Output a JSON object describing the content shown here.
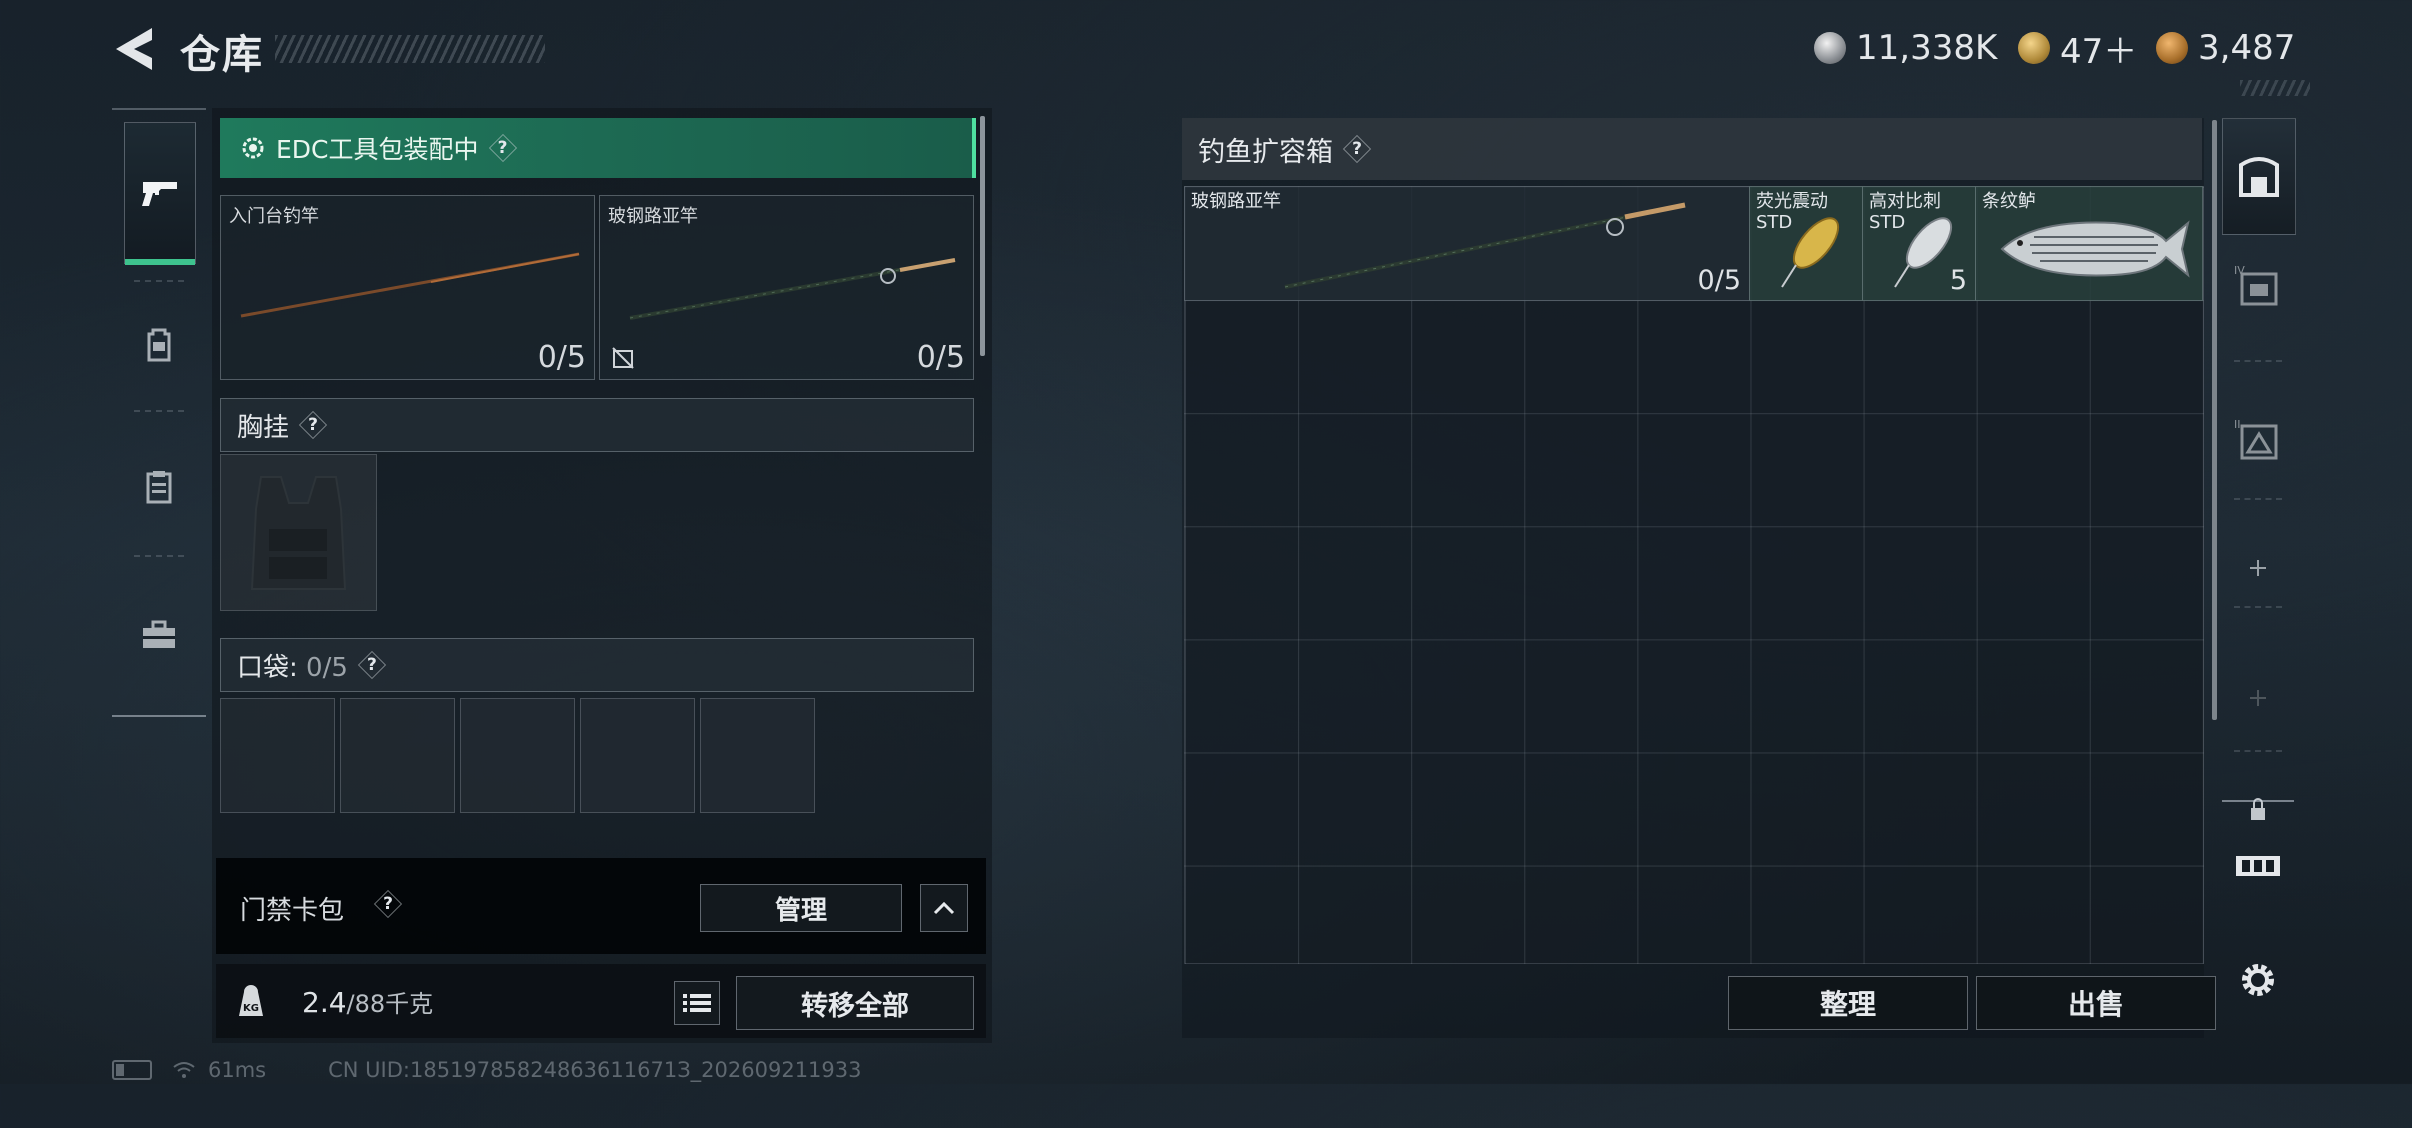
{
  "header": {
    "title": "仓库",
    "currencies": [
      {
        "icon": "silver-coin-icon",
        "value": "11,338K"
      },
      {
        "icon": "gold-triangle-coin-icon",
        "value": "47＋"
      },
      {
        "icon": "bronze-coin-icon",
        "value": "3,487"
      }
    ]
  },
  "colors": {
    "accent_green": "#1f7a5c",
    "accent_green_edge": "#4fe0a0",
    "panel_bg": "#0e141a"
  },
  "left_tabs": [
    {
      "icon": "pistol-icon",
      "active": true
    },
    {
      "icon": "backpack-icon",
      "active": false
    },
    {
      "icon": "clipboard-icon",
      "active": false
    },
    {
      "icon": "toolbox-icon",
      "active": false
    }
  ],
  "edc": {
    "label": "EDC工具包装配中",
    "help": "?"
  },
  "rods": [
    {
      "name": "入门台钓竿",
      "count": "0/5"
    },
    {
      "name": "玻钢路亚竿",
      "count": "0/5"
    }
  ],
  "chest": {
    "label": "胸挂",
    "help": "?"
  },
  "pocket": {
    "label": "口袋: ",
    "value": "0/5",
    "help": "?"
  },
  "card": {
    "label": "门禁卡包",
    "help": "?",
    "manage": "管理"
  },
  "weight": {
    "value": "2.4",
    "max": "/88千克",
    "transfer": "转移全部"
  },
  "container": {
    "title": "钓鱼扩容箱",
    "help": "?",
    "items": [
      {
        "name": "玻钢路亚竿",
        "count": "0/5"
      },
      {
        "name": "荧光震动\nSTD",
        "count": ""
      },
      {
        "name": "高对比刺\nSTD",
        "count": "5"
      },
      {
        "name": "条纹鲈",
        "count": ""
      }
    ],
    "sort": "整理",
    "sell": "出售"
  },
  "right_tabs": [
    {
      "icon": "safe-box-icon"
    },
    {
      "icon": "container-iv-icon"
    },
    {
      "icon": "container-ii-icon"
    },
    {
      "icon": "plus-icon"
    },
    {
      "icon": "plus-icon"
    },
    {
      "icon": "lock-icon"
    },
    {
      "icon": "item-swap-icon"
    },
    {
      "icon": "gear-icon"
    }
  ],
  "status": {
    "ping": "61ms",
    "uid": "CN UID:18519785824863611671З_202609211933"
  }
}
